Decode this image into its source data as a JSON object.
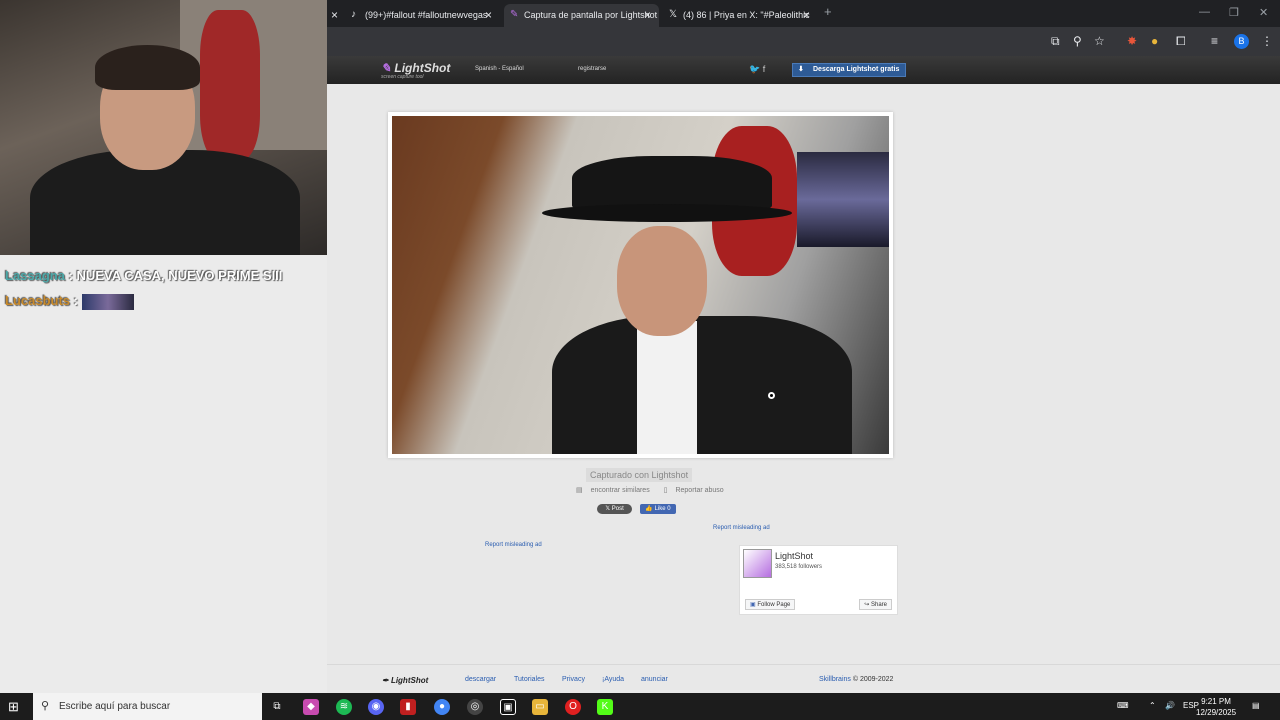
{
  "overlay": {
    "chat": [
      {
        "user": "Lassagna",
        "sep": " : ",
        "msg": "NUEVA CASA, NUEVO PRIME SIII"
      },
      {
        "user": "Lucasbuts",
        "sep": " : ",
        "msg": ""
      }
    ]
  },
  "browser": {
    "tabs": [
      {
        "label": "(99+)#fallout #falloutnewvegas",
        "icon": "tiktok-icon"
      },
      {
        "label": "Captura de pantalla por Lightshot",
        "icon": "lightshot-feather-icon"
      },
      {
        "label": "(4) 86 | Priya en X: \"#Paleolithic",
        "icon": "x-logo-icon"
      }
    ],
    "new_tab": "+",
    "close": "×"
  },
  "lightshot": {
    "logo": "LightShot",
    "tagline": "screen capture tool",
    "language": "Spanish - Español",
    "register": "registrarse",
    "download_btn": "Descarga Lightshot gratis",
    "captured": "Capturado con Lightshot",
    "find_similar": "encontrar similares",
    "report_abuse": "Reportar abuso",
    "post": "Post",
    "like": "Like 0",
    "report_ad_1": "Report misleading ad",
    "report_ad_2": "Report misleading ad",
    "fb": {
      "name": "LightShot",
      "followers": "383,518 followers",
      "follow": "Follow Page",
      "share": "Share"
    },
    "footer": {
      "logo": "LightShot",
      "links": [
        "descargar",
        "Tutoriales",
        "Privacy",
        "¡Ayuda",
        "anunciar"
      ],
      "brand": "Skillbrains",
      "copyright": "© 2009-2022"
    }
  },
  "taskbar": {
    "search_placeholder": "Escribe aquí para buscar",
    "lang": "ESP",
    "time": "9:21 PM",
    "date": "12/29/2025"
  },
  "colors": {
    "accent": "#2e5b96",
    "link": "#2a5db0",
    "fb_blue": "#4267b2"
  }
}
